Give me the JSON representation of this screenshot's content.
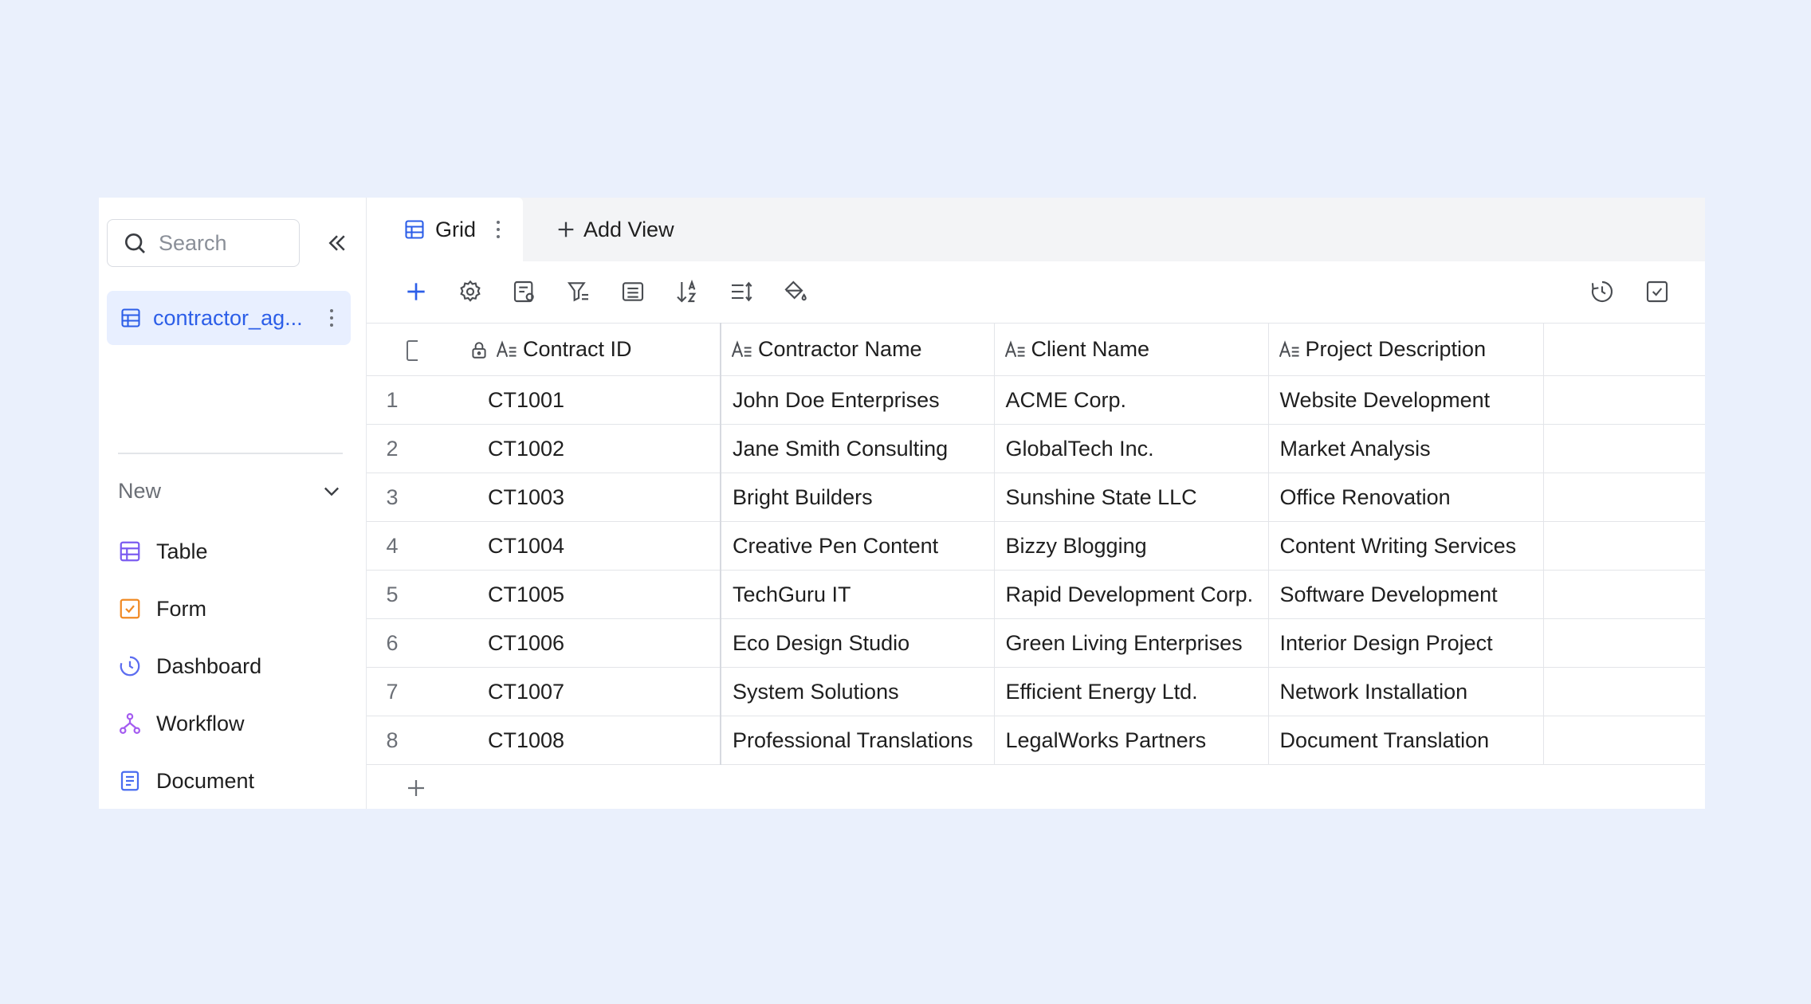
{
  "sidebar": {
    "search_placeholder": "Search",
    "active_table": "contractor_ag...",
    "new_label": "New",
    "create_items": [
      {
        "label": "Table",
        "icon": "table-icon",
        "color": "#7b5cf0"
      },
      {
        "label": "Form",
        "icon": "form-icon",
        "color": "#f08a24"
      },
      {
        "label": "Dashboard",
        "icon": "dashboard-icon",
        "color": "#5b6cf0"
      },
      {
        "label": "Workflow",
        "icon": "workflow-icon",
        "color": "#a45cf0"
      },
      {
        "label": "Document",
        "icon": "document-icon",
        "color": "#4a6cf0"
      }
    ]
  },
  "tabs": {
    "grid_label": "Grid",
    "add_view_label": "Add View"
  },
  "grid": {
    "columns": [
      "Contract ID",
      "Contractor Name",
      "Client Name",
      "Project Description"
    ],
    "rows": [
      {
        "num": "1",
        "id": "CT1001",
        "contractor": "John Doe Enterprises",
        "client": "ACME Corp.",
        "project": "Website Development"
      },
      {
        "num": "2",
        "id": "CT1002",
        "contractor": "Jane Smith Consulting",
        "client": "GlobalTech Inc.",
        "project": "Market Analysis"
      },
      {
        "num": "3",
        "id": "CT1003",
        "contractor": "Bright Builders",
        "client": "Sunshine State LLC",
        "project": "Office Renovation"
      },
      {
        "num": "4",
        "id": "CT1004",
        "contractor": "Creative Pen Content",
        "client": "Bizzy Blogging",
        "project": "Content Writing Services"
      },
      {
        "num": "5",
        "id": "CT1005",
        "contractor": "TechGuru IT",
        "client": "Rapid Development Corp.",
        "project": "Software Development"
      },
      {
        "num": "6",
        "id": "CT1006",
        "contractor": "Eco Design Studio",
        "client": "Green Living Enterprises",
        "project": "Interior Design Project"
      },
      {
        "num": "7",
        "id": "CT1007",
        "contractor": "System Solutions",
        "client": "Efficient Energy Ltd.",
        "project": "Network Installation"
      },
      {
        "num": "8",
        "id": "CT1008",
        "contractor": "Professional Translations",
        "client": "LegalWorks Partners",
        "project": "Document Translation"
      }
    ]
  },
  "colors": {
    "accent": "#2c5ee8",
    "background": "#eaf0fc",
    "active_bg": "#e8efff"
  }
}
